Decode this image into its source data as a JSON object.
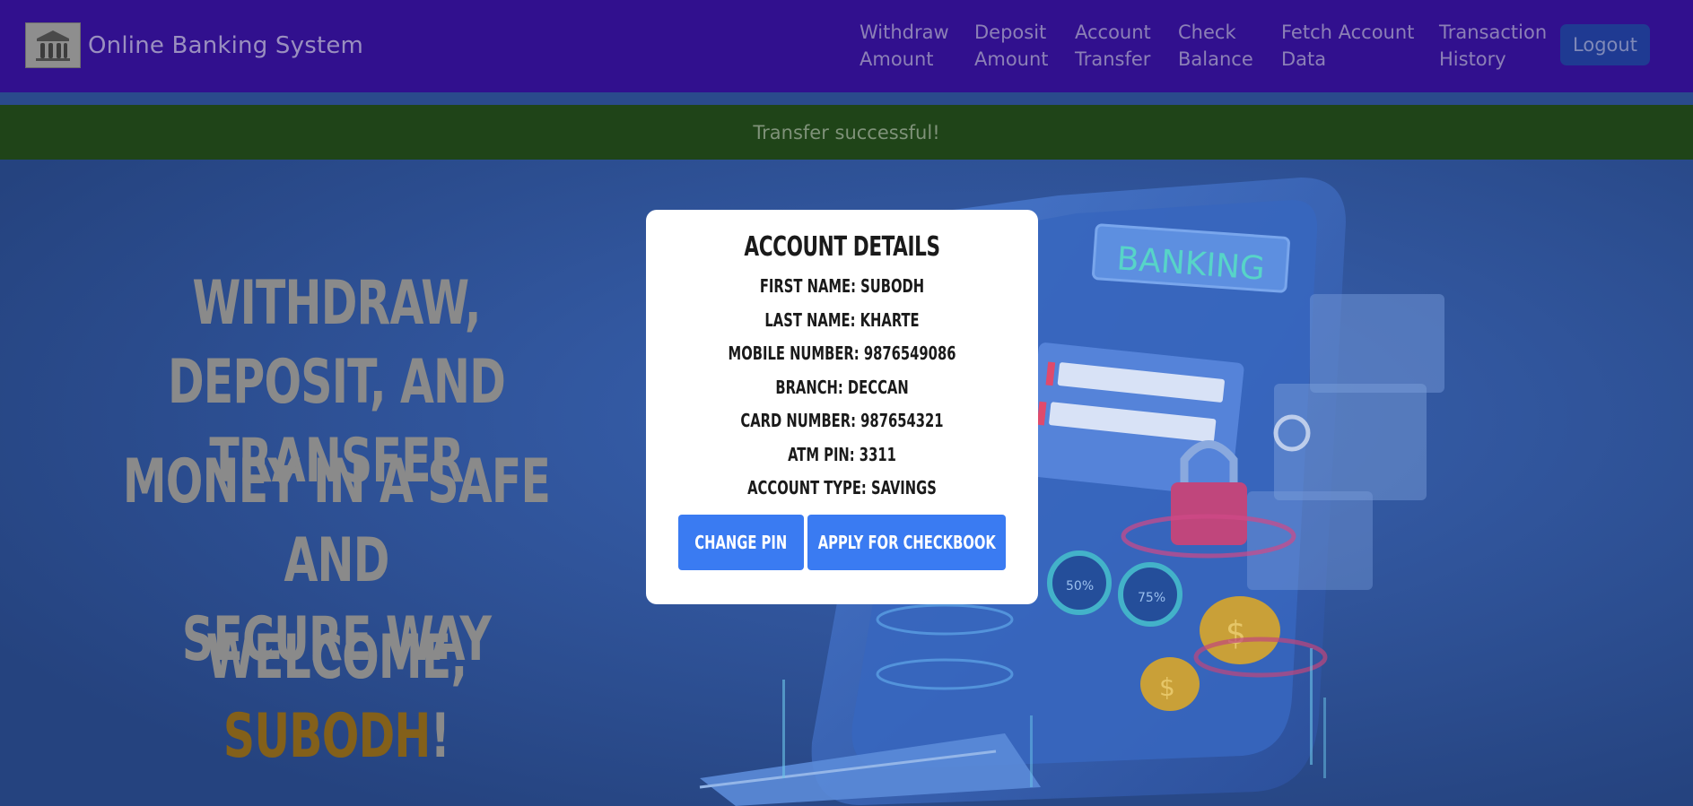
{
  "navbar": {
    "brand": "Online Banking System",
    "items": [
      {
        "line1": "Withdraw",
        "line2": "Amount"
      },
      {
        "line1": "Deposit",
        "line2": "Amount"
      },
      {
        "line1": "Account",
        "line2": "Transfer"
      },
      {
        "line1": "Check",
        "line2": "Balance"
      },
      {
        "line1": "Fetch Account",
        "line2": "Data"
      },
      {
        "line1": "Transaction",
        "line2": "History"
      }
    ],
    "logout": "Logout"
  },
  "alert": {
    "message": "Transfer successful!"
  },
  "hero": {
    "line1": "Withdraw, Deposit, and",
    "line1b": "Transfer",
    "line2": "Money in a Safe and",
    "line2b": "Secure Way",
    "welcome_prefix": "Welcome, ",
    "welcome_name": "SUBODH",
    "welcome_suffix": "!",
    "illustration_text": "BANKING"
  },
  "modal": {
    "title": "Account Details",
    "fields": [
      "First Name: SUBODH",
      "Last Name: KHARTE",
      "Mobile Number: 9876549086",
      "Branch: DECCAN",
      "Card Number: 987654321",
      "ATM PIN: 3311",
      "Account Type: SAVINGS"
    ],
    "change_pin": "Change PIN",
    "apply_checkbook": "Apply for Checkbook"
  },
  "colors": {
    "navbar": "#31108e",
    "alert": "#1f4418",
    "accent_button": "#3a7bf2",
    "welcome_name": "#83601a"
  }
}
